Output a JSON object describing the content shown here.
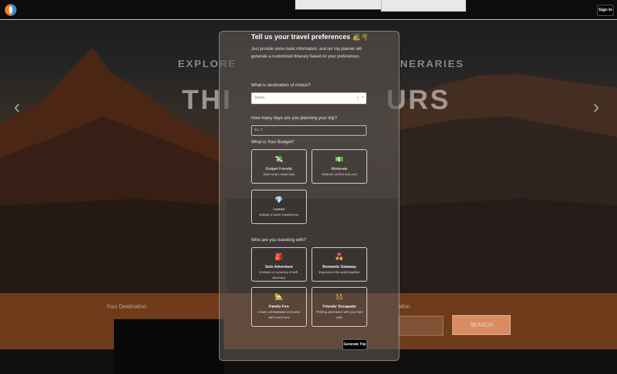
{
  "navbar": {
    "signin_label": "Sign In"
  },
  "hero": {
    "line_left": "EXPLORE",
    "line_right": "NERARIES",
    "big_left": "THI",
    "big_right": "URS",
    "prev_icon": "‹",
    "next_icon": "›"
  },
  "bottom_bar": {
    "label_left": "Your Destination",
    "label_right": "ation",
    "search_label": "SEARCH"
  },
  "form": {
    "title": "Tell us your travel preferences 🏕️🌴",
    "subtitle": "Just provide some basic information, and our trip planner will generate a customized itinerary based on your preferences.",
    "destination_question": "What is destination of choice?",
    "destination_placeholder": "Select...",
    "days_question": "How many days are you planning your trip?",
    "days_placeholder": "Ex. 3",
    "budget_question": "What is Your Budget?",
    "budget_options": [
      {
        "icon": "💸",
        "title": "Budget-Friendly",
        "desc": "Save smart, travel wise"
      },
      {
        "icon": "💵",
        "title": "Moderate",
        "desc": "Balance comfort and cost"
      },
      {
        "icon": "💎",
        "title": "Luxury",
        "desc": "Indulge in lavish experiences"
      }
    ],
    "travel_question": "Who are you traveling with?",
    "travel_options": [
      {
        "icon": "🎒",
        "title": "Solo Adventure",
        "desc": "Embark on a journey of self-discovery"
      },
      {
        "icon": "👩‍❤️‍👨",
        "title": "Romantic Getaway",
        "desc": "Experience the world together"
      },
      {
        "icon": "🏡",
        "title": "Family Fun",
        "desc": "Create unforgettable memories with loved ones"
      },
      {
        "icon": "👯",
        "title": "Friends' Escapade",
        "desc": "Thrilling adventures with your best pals"
      }
    ],
    "generate_label": "Generate Trip"
  }
}
